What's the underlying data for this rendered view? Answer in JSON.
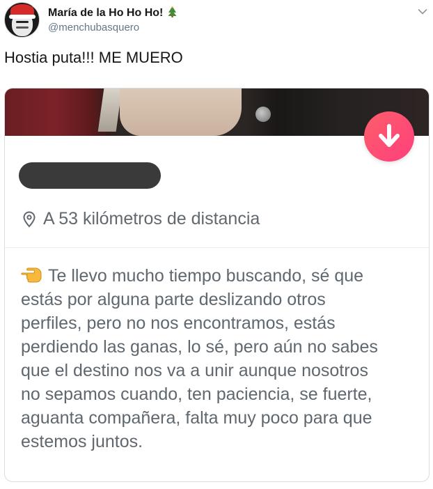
{
  "tweet": {
    "display_name": "María de la Ho Ho Ho!",
    "handle": "@menchubasquero",
    "name_emoji": "christmas-tree-icon",
    "text": "Hostia puta!!! ME MUERO"
  },
  "profile_card": {
    "name": "",
    "dislike_icon": "arrow-down-icon",
    "distance": "A 53 kilómetros de distancia",
    "bio_emoji": "pointing-hand-icon",
    "bio_lines": [
      "Te llevo mucho tiempo buscando, sé que",
      "estás por alguna parte deslizando otros",
      "perfiles, pero no nos encontramos, estás",
      "perdiendo las ganas, lo sé, pero aún no sabes",
      "que el destino nos va a unir aunque nosotros",
      "no sepamos cuando, ten paciencia, se fuerte,",
      "aguanta compañera, falta muy poco para que",
      "estemos juntos."
    ]
  },
  "colors": {
    "accent_gradient_start": "#fd5e6a",
    "accent_gradient_end": "#fe3f7c",
    "handle_gray": "#657786",
    "bio_gray": "#5f676f"
  }
}
